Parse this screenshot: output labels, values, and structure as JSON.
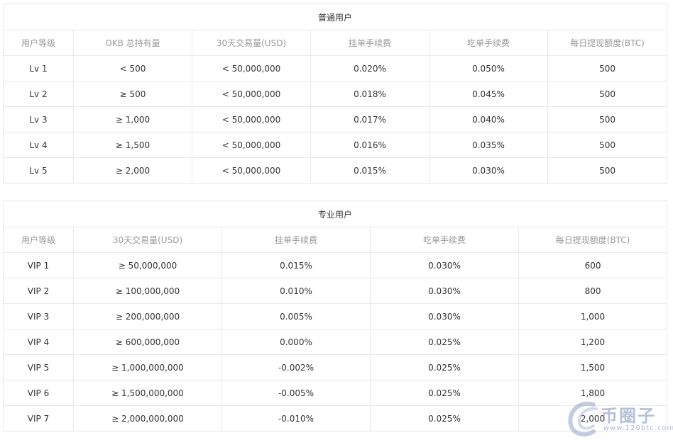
{
  "normal_table": {
    "title": "普通用户",
    "headers": [
      "用户等级",
      "OKB 总持有量",
      "30天交易量(USD)",
      "挂单手续费",
      "吃单手续费",
      "每日提现额度(BTC)"
    ],
    "rows": [
      [
        "Lv 1",
        "< 500",
        "< 50,000,000",
        "0.020%",
        "0.050%",
        "500"
      ],
      [
        "Lv 2",
        "≥ 500",
        "< 50,000,000",
        "0.018%",
        "0.045%",
        "500"
      ],
      [
        "Lv 3",
        "≥ 1,000",
        "< 50,000,000",
        "0.017%",
        "0.040%",
        "500"
      ],
      [
        "Lv 4",
        "≥ 1,500",
        "< 50,000,000",
        "0.016%",
        "0.035%",
        "500"
      ],
      [
        "Lv 5",
        "≥ 2,000",
        "< 50,000,000",
        "0.015%",
        "0.030%",
        "500"
      ]
    ]
  },
  "pro_table": {
    "title": "专业用户",
    "headers": [
      "用户等级",
      "30天交易量(USD)",
      "挂单手续费",
      "吃单手续费",
      "每日提现额度(BTC)"
    ],
    "rows": [
      [
        "VIP 1",
        "≥ 50,000,000",
        "0.015%",
        "0.030%",
        "600"
      ],
      [
        "VIP 2",
        "≥ 100,000,000",
        "0.010%",
        "0.030%",
        "800"
      ],
      [
        "VIP 3",
        "≥ 200,000,000",
        "0.005%",
        "0.030%",
        "1,000"
      ],
      [
        "VIP 4",
        "≥ 600,000,000",
        "0.000%",
        "0.025%",
        "1,200"
      ],
      [
        "VIP 5",
        "≥ 1,000,000,000",
        "-0.002%",
        "0.025%",
        "1,500"
      ],
      [
        "VIP 6",
        "≥ 1,500,000,000",
        "-0.005%",
        "0.025%",
        "1,800"
      ],
      [
        "VIP 7",
        "≥ 2,000,000,000",
        "-0.010%",
        "0.025%",
        "2,000"
      ]
    ]
  },
  "watermark": {
    "logo_icon": "swirl-logo-icon",
    "brand_text": "币圈子",
    "url_text": "www.120btc.com",
    "color": "#8fa3c8"
  }
}
